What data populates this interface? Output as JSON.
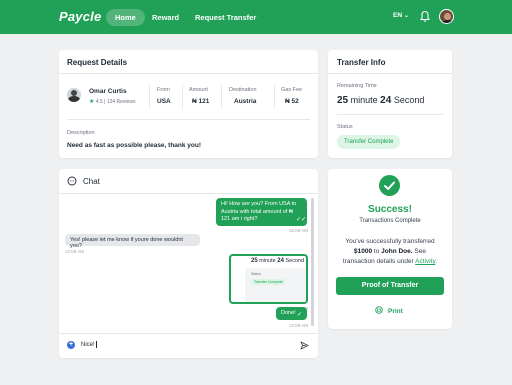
{
  "nav": {
    "logo": "Paycle",
    "links": [
      "Home",
      "Reward",
      "Request Transfer"
    ],
    "language": "EN",
    "brand_color": "#21a157"
  },
  "request_details": {
    "title": "Request Details",
    "user": {
      "name": "Omar Curtis",
      "rating": "4.5",
      "reviews": "124 Reviews"
    },
    "columns": [
      {
        "label": "From",
        "value": "USA"
      },
      {
        "label": "Amount",
        "value": "₦ 121"
      },
      {
        "label": "Destination",
        "value": "Austria"
      },
      {
        "label": "Gas Fee",
        "value": "₦ 52"
      }
    ],
    "description_label": "Description",
    "description": "Need as fast as possible please, thank you!"
  },
  "transfer_info": {
    "title": "Transfer Info",
    "remaining_label": "Remaining Time",
    "minutes": "25",
    "minute_word": "minute",
    "seconds": "24",
    "second_word": "Second",
    "status_label": "Status",
    "status": "Transfer Complete"
  },
  "chat": {
    "title": "Chat",
    "messages": [
      {
        "text": "Hi! How are you? From USA to Austria with total amount of ₦ 121 am i right?",
        "time": "12:08 AM",
        "direction": "out"
      },
      {
        "text": "Yes! please let me know if youre done wouldnt you?",
        "time": "12:08 AM",
        "direction": "in"
      },
      {
        "text": "",
        "time": "12:08 AM",
        "direction": "out",
        "attachment": "transfer screenshot"
      },
      {
        "text": "Done!",
        "time": "12:08 AM",
        "direction": "out"
      }
    ],
    "screenshot": {
      "minutes": "25",
      "minute_word": "minute",
      "seconds": "24",
      "second_word": "Second",
      "status_label": "Status",
      "status": "Transfer Complete"
    },
    "input_value": "Nice!"
  },
  "success": {
    "title": "Success!",
    "subtitle": "Transactions Complete",
    "text_pre": "You've successfully transferred",
    "amount": "$1000",
    "text_to": "to",
    "recipient": "John Doe.",
    "text_post": "See transaction details under",
    "link": "Activity",
    "period": ".",
    "proof_button": "Proof of Transfer",
    "print": "Print"
  }
}
